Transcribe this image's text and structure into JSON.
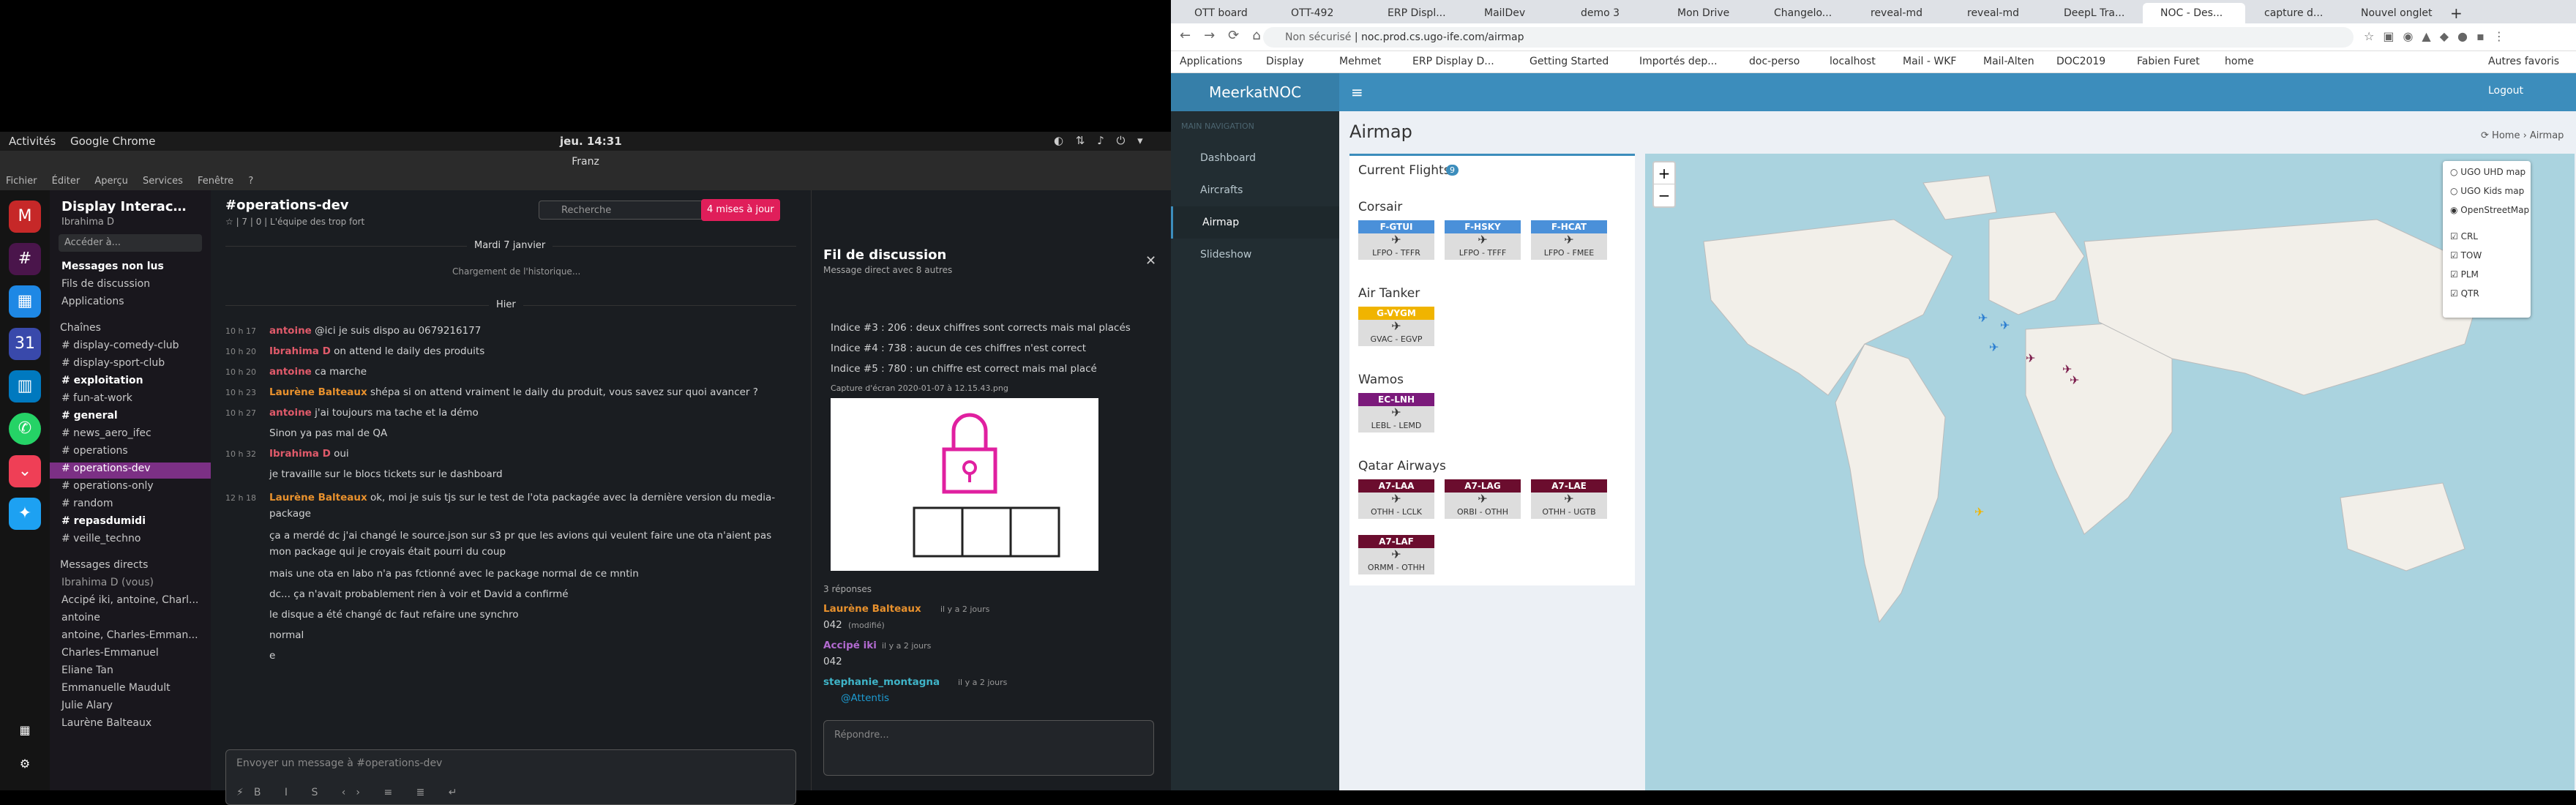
{
  "gnome": {
    "activities": "Activités",
    "app": "Google Chrome",
    "clock": "jeu. 14:31"
  },
  "franz": {
    "title": "Franz",
    "menu": [
      "Fichier",
      "Éditer",
      "Aperçu",
      "Services",
      "Fenêtre",
      "?"
    ]
  },
  "slack": {
    "workspace": "Display Interac…",
    "user": "Ibrahima D",
    "jump": "Accéder à...",
    "nav": [
      "Messages non lus",
      "Fils de discussion",
      "Applications"
    ],
    "channels_header": "Chaînes",
    "channels": [
      "# display-comedy-club",
      "# display-sport-club",
      "# exploitation",
      "# fun-at-work",
      "# general",
      "# news_aero_ifec",
      "# operations",
      "# operations-dev",
      "# operations-only",
      "# random",
      "# repasdumidi",
      "# veille_techno"
    ],
    "dm_header": "Messages directs",
    "dms": [
      "Ibrahima D (vous)",
      "Accipé iki, antoine, Charl...",
      "antoine",
      "antoine, Charles-Emman...",
      "Charles-Emmanuel",
      "Eliane Tan",
      "Emmanuelle Maudult",
      "Julie Alary",
      "Laurène Balteaux"
    ],
    "channel": {
      "name": "#operations-dev",
      "meta": "☆ | 7 | 0 | L'équipe des trop fort",
      "search": "Recherche",
      "update": "4 mises à jour",
      "date1": "Mardi 7 janvier",
      "loading": "Chargement de l'historique...",
      "date2": "Hier"
    },
    "messages": [
      {
        "time": "10 h 17",
        "name": "antoine",
        "text": "@ici je suis dispo au 0679216177"
      },
      {
        "time": "10 h 20",
        "name": "Ibrahima D",
        "text": "on attend le daily des produits"
      },
      {
        "time": "10 h 20",
        "name": "antoine",
        "text": "ca marche"
      },
      {
        "time": "10 h 23",
        "name": "Laurène Balteaux",
        "text": "shépa si on attend vraiment le daily du produit, vous savez sur quoi avancer ?"
      },
      {
        "time": "10 h 27",
        "name": "antoine",
        "text": "j'ai toujours ma tache et la démo"
      },
      {
        "time": "",
        "name": "",
        "text": "Sinon ya pas mal de QA"
      },
      {
        "time": "10 h 32",
        "name": "Ibrahima D",
        "text": "oui"
      },
      {
        "time": "",
        "name": "",
        "text": "je travaille sur le blocs tickets sur le dashboard"
      },
      {
        "time": "12 h 18",
        "name": "Laurène Balteaux",
        "text": "ok, moi je suis tjs sur le test de l'ota packagée avec la dernière version du media-"
      },
      {
        "time": "",
        "name": "",
        "text": "package"
      },
      {
        "time": "",
        "name": "",
        "text": "ça a merdé dc j'ai changé le source.json sur s3 pr que les avions qui veulent faire une ota n'aient pas"
      },
      {
        "time": "",
        "name": "",
        "text": "mon package qui je croyais était pourri du coup"
      },
      {
        "time": "",
        "name": "",
        "text": "mais une ota en labo n'a pas fctionné avec le package normal de ce mntin"
      },
      {
        "time": "",
        "name": "",
        "text": "dc... ça n'avait probablement rien à voir et David a confirmé"
      },
      {
        "time": "",
        "name": "",
        "text": "le disque a été changé dc faut refaire une synchro"
      },
      {
        "time": "",
        "name": "",
        "text": "normal"
      },
      {
        "time": "",
        "name": "",
        "text": "e"
      }
    ],
    "composer": "Envoyer un message à #operations-dev",
    "thread": {
      "title": "Fil de discussion",
      "subtitle": "Message direct avec 8 autres",
      "lines": [
        "Indice #3 : 206 : deux chiffres sont corrects mais mal placés",
        "Indice #4 : 738 : aucun de ces chiffres n'est correct",
        "Indice #5 : 780 : un chiffre est correct mais mal placé"
      ],
      "capture": "Capture d'écran 2020-01-07 à 12.15.43.png",
      "replies": "3 réponses",
      "r1": {
        "name": "Laurène Balteaux",
        "time": "il y a 2 jours",
        "text": "042",
        "extra": "(modifié)"
      },
      "r2": {
        "name": "Accipé iki",
        "time": "il y a 2 jours",
        "text": "042"
      },
      "r3": {
        "name": "stephanie_montagna",
        "time": "il y a 2 jours",
        "text": "@Attentis"
      },
      "reply": "Répondre..."
    }
  },
  "chrome": {
    "tabs": [
      "OTT board",
      "OTT-492",
      "ERP Displ...",
      "MailDev",
      "demo 3",
      "Mon Drive",
      "Changelo...",
      "reveal-md",
      "reveal-md",
      "DeepL Tra...",
      "NOC - Des...",
      "capture d...",
      "Nouvel onglet"
    ],
    "url_prefix": "Non sécurisé",
    "url": "noc.prod.cs.ugo-ife.com/airmap",
    "bookmarks": [
      "Applications",
      "Display",
      "Mehmet",
      "ERP Display D...",
      "Getting Started",
      "Importés dep...",
      "doc-perso",
      "localhost",
      "Mail - WKF",
      "Mail-Alten",
      "DOC2019",
      "Fabien Furet",
      "home",
      "Autres favoris"
    ]
  },
  "noc": {
    "logo": "MeerkatNOC",
    "logout": "Logout",
    "nav_header": "MAIN NAVIGATION",
    "nav": [
      "Dashboard",
      "Aircrafts",
      "Airmap",
      "Slideshow"
    ],
    "page_title": "Airmap",
    "crumb_home": "Home",
    "crumb_page": "Airmap",
    "flights_title": "Current Flights",
    "flights_count": "9",
    "airlines": [
      {
        "name": "Corsair",
        "color": "#4a90d9",
        "flights": [
          {
            "reg": "F-GTUI",
            "route": "LFPO - TFFR"
          },
          {
            "reg": "F-HSKY",
            "route": "LFPO - TFFF"
          },
          {
            "reg": "F-HCAT",
            "route": "LFPO - FMEE"
          }
        ]
      },
      {
        "name": "Air Tanker",
        "color": "#f0b400",
        "flights": [
          {
            "reg": "G-VYGM",
            "route": "GVAC - EGVP"
          }
        ]
      },
      {
        "name": "Wamos",
        "color": "#7b1a7b",
        "flights": [
          {
            "reg": "EC-LNH",
            "route": "LEBL - LEMD"
          }
        ]
      },
      {
        "name": "Qatar Airways",
        "color": "#6b0d2e",
        "flights": [
          {
            "reg": "A7-LAA",
            "route": "OTHH - LCLK"
          },
          {
            "reg": "A7-LAG",
            "route": "ORBI - OTHH"
          },
          {
            "reg": "A7-LAE",
            "route": "OTHH - UGTB"
          },
          {
            "reg": "A7-LAF",
            "route": "ORMM - OTHH"
          }
        ]
      }
    ],
    "layers": [
      "UGO UHD map",
      "UGO Kids map",
      "OpenStreetMap",
      "CRL",
      "TOW",
      "PLM",
      "QTR"
    ]
  }
}
